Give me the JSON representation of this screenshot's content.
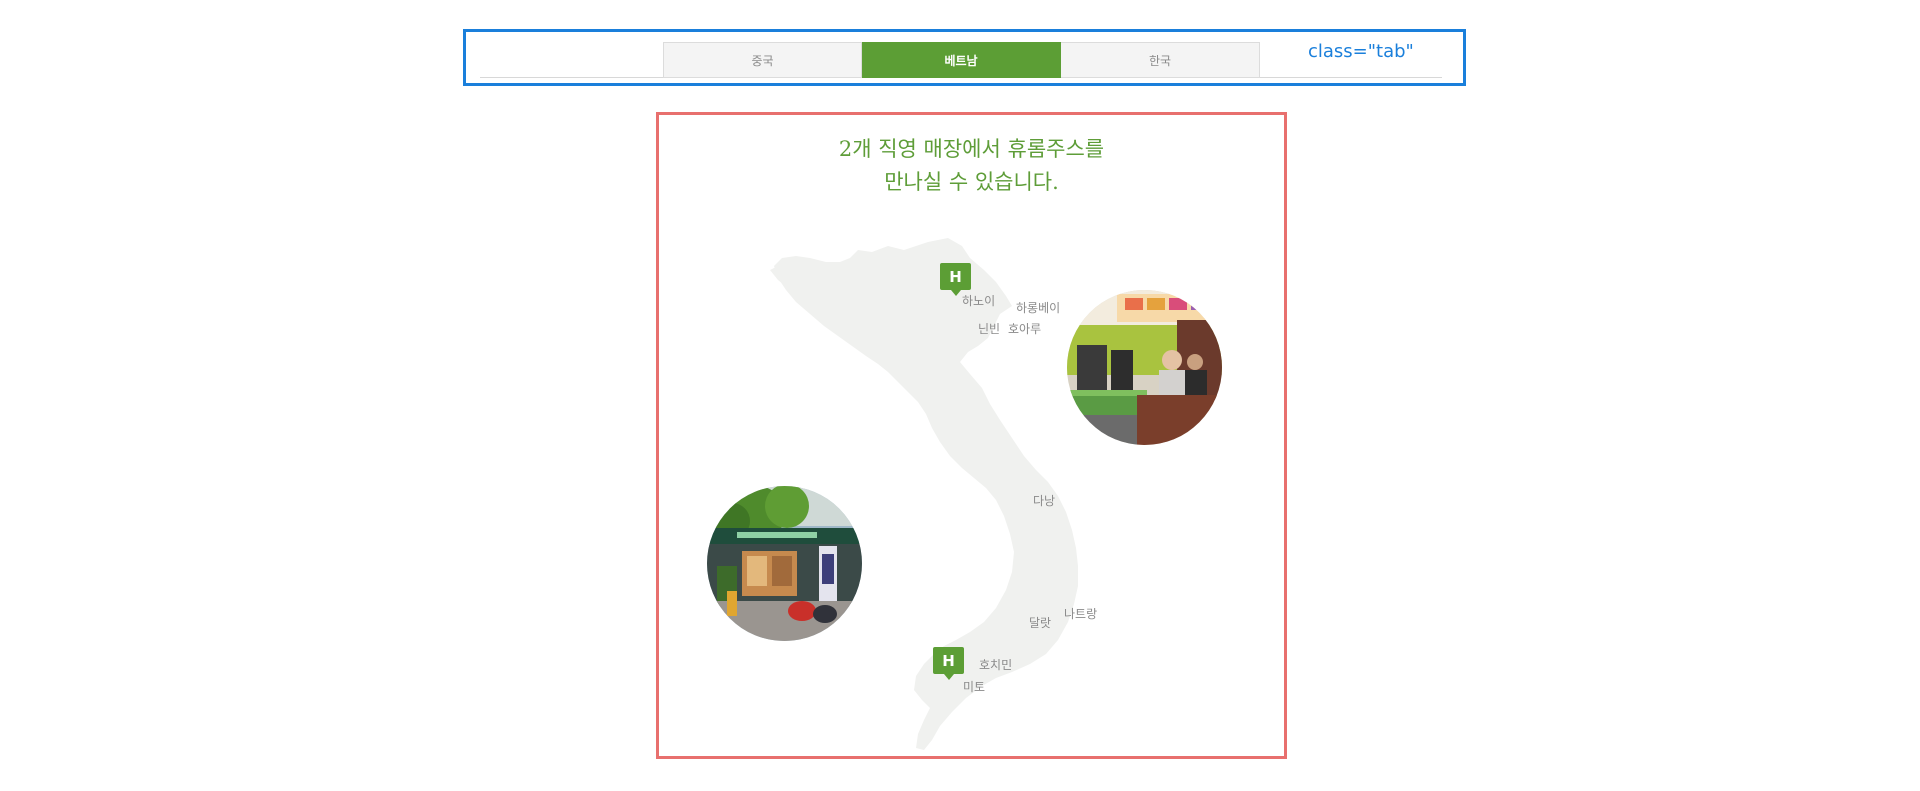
{
  "tabs": {
    "items": [
      {
        "label": "중국",
        "active": false
      },
      {
        "label": "베트남",
        "active": true
      },
      {
        "label": "한국",
        "active": false
      }
    ],
    "annotation": "class=\"tab\""
  },
  "map_section": {
    "headline_line1": "2개 직영 매장에서 휴롬주스를",
    "headline_line2": "만나실 수 있습니다.",
    "marker_icon": "H",
    "cities": {
      "hanoi": "하노이",
      "halong": "하롱베이",
      "ninhbinh": "닌빈",
      "haiphong": "호아루",
      "danang": "다낭",
      "nhatrang": "나트랑",
      "dalat": "달랏",
      "hochiminh": "호치민",
      "mytho": "미토"
    }
  },
  "colors": {
    "accent_green": "#5c9e35",
    "annotation_blue": "#1a7fdb",
    "annotation_red": "#e8706e",
    "map_fill": "#f0f1ef"
  }
}
